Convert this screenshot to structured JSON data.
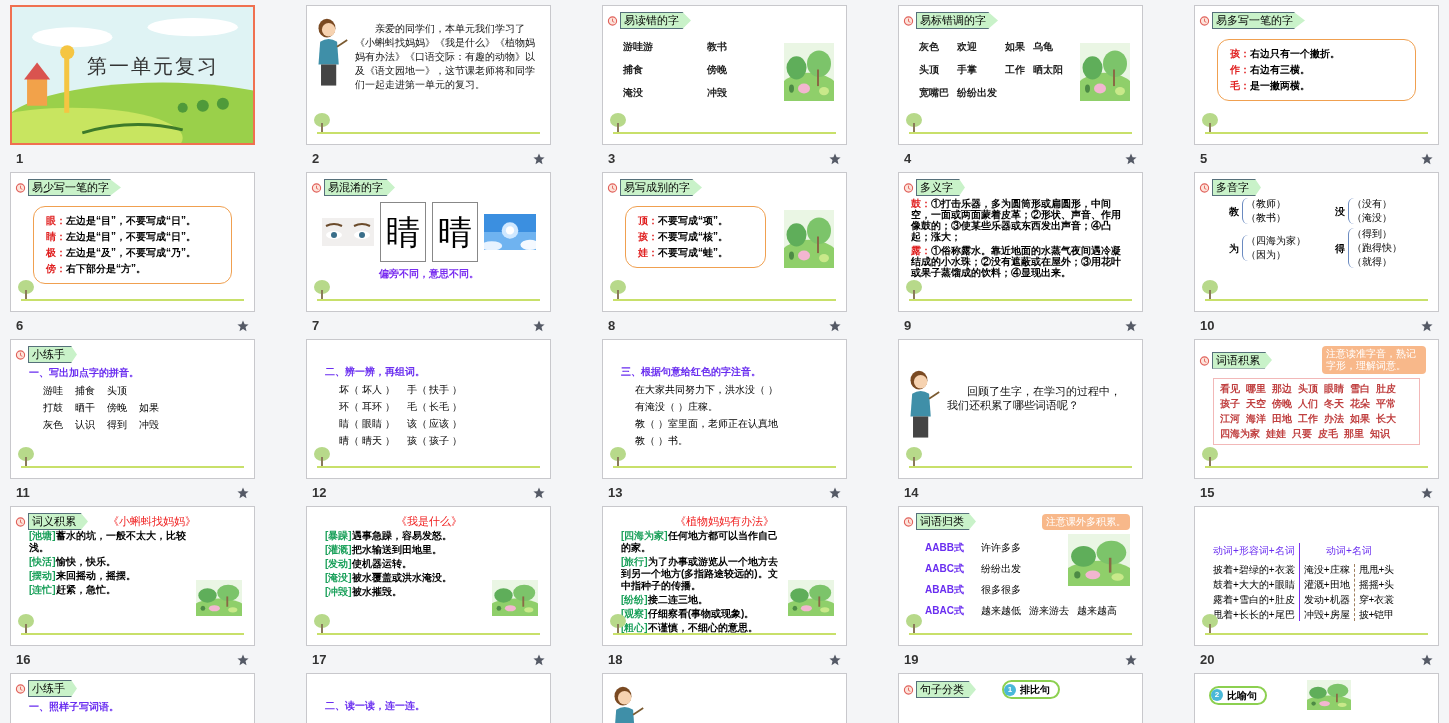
{
  "slides": [
    {
      "number": "1",
      "selected": true,
      "kind": "title",
      "title": "第一单元复习"
    },
    {
      "number": "2",
      "selected": false,
      "animated": true,
      "kind": "teacher",
      "text": "亲爱的同学们，本单元我们学习了《小蝌蚪找妈妈》《我是什么》《植物妈妈有办法》《口语交际：有趣的动物》以及《语文园地一》，这节课老师将和同学们一起走进第一单元的复习。"
    },
    {
      "number": "3",
      "selected": false,
      "animated": true,
      "kind": "words",
      "tag": "易读错的字",
      "picture": true,
      "words": [
        "游哇游",
        "教书",
        "捕食",
        "傍晚",
        "淹没",
        "冲毁"
      ]
    },
    {
      "number": "4",
      "selected": false,
      "animated": true,
      "kind": "words",
      "tag": "易标错调的字",
      "picture": true,
      "words": [
        "灰色",
        "欢迎",
        "如果",
        "乌龟",
        "头顶",
        "手掌",
        "工作",
        "晒太阳",
        "宽嘴巴",
        "纷纷出发"
      ]
    },
    {
      "number": "5",
      "selected": false,
      "animated": true,
      "kind": "boxed",
      "tag": "易多写一笔的字",
      "lines": [
        {
          "label": "孩：",
          "text": "右边只有一个撇折。"
        },
        {
          "label": "作：",
          "text": "右边有三横。"
        },
        {
          "label": "毛：",
          "text": "是一撇两横。"
        }
      ]
    },
    {
      "number": "6",
      "selected": false,
      "animated": true,
      "kind": "boxed",
      "tag": "易少写一笔的字",
      "lines": [
        {
          "label": "眼：",
          "text": "左边是“目”，不要写成“日”。"
        },
        {
          "label": "睛：",
          "text": "左边是“目”，不要写成“日”。"
        },
        {
          "label": "极：",
          "text": "左边是“及”，不要写成“乃”。"
        },
        {
          "label": "傍：",
          "text": "右下部分是“方”。"
        }
      ]
    },
    {
      "number": "7",
      "selected": false,
      "animated": true,
      "kind": "compare",
      "tag": "易混淆的字",
      "chars": [
        "睛",
        "晴"
      ],
      "caption": "偏旁不同，意思不同。"
    },
    {
      "number": "8",
      "selected": false,
      "animated": true,
      "kind": "boxed",
      "tag": "易写成别的字",
      "picture": true,
      "lines": [
        {
          "label": "顶：",
          "text": "不要写成“项”。"
        },
        {
          "label": "孩：",
          "text": "不要写成“核”。"
        },
        {
          "label": "娃：",
          "text": "不要写成“蛙”。"
        }
      ]
    },
    {
      "number": "9",
      "selected": false,
      "animated": true,
      "kind": "defs",
      "tag": "多义字",
      "lines": [
        {
          "label": "鼓：",
          "text": "①打击乐器，多为圆筒形或扁圆形，中间空，一面或两面蒙着皮革；②形状、声音、作用像鼓的；③使某些乐器或东西发出声音；④凸起；涨大；"
        },
        {
          "label": "露：",
          "text": "①俗称露水。靠近地面的水蒸气夜间遇冷凝结成的小水珠；②没有遮蔽或在屋外；③用花叶或果子蒸馏成的饮料；④显现出来。"
        }
      ]
    },
    {
      "number": "10",
      "selected": false,
      "animated": true,
      "kind": "polyphone",
      "tag": "多音字",
      "groups": [
        {
          "char": "教",
          "readings": [
            "（教师）",
            "（教书）"
          ]
        },
        {
          "char": "没",
          "readings": [
            "（没有）",
            "（淹没）"
          ]
        },
        {
          "char": "为",
          "readings": [
            "（四海为家）",
            "（因为）"
          ]
        },
        {
          "char": "得",
          "readings": [
            "（得到）",
            "（跑得快）",
            "（就得）"
          ]
        }
      ]
    },
    {
      "number": "11",
      "selected": false,
      "animated": true,
      "kind": "exercise",
      "tag": "小练手",
      "prompt": "一、写出加点字的拼音。",
      "rows": [
        [
          "游哇",
          "捕食",
          "头顶"
        ],
        [
          "打鼓",
          "晒干",
          "傍晚",
          "如果"
        ],
        [
          "灰色",
          "认识",
          "得到",
          "冲毁"
        ]
      ]
    },
    {
      "number": "12",
      "selected": false,
      "animated": true,
      "kind": "exercise",
      "prompt": "二、辨一辨，再组词。",
      "rows": [
        [
          "坏（ 坏人 ）",
          "手（ 扶手 ）"
        ],
        [
          "环（ 耳环 ）",
          "毛（ 长毛 ）"
        ],
        [
          "睛（ 眼睛 ）",
          "该（ 应该 ）"
        ],
        [
          "晴（ 晴天 ）",
          "孩（ 孩子 ）"
        ]
      ]
    },
    {
      "number": "13",
      "selected": false,
      "animated": true,
      "kind": "exercise",
      "prompt": "三、根据句意给红色的字注音。",
      "rows": [
        [
          "在大家共同努力下，洪水没（  ）"
        ],
        [
          "有淹没（  ）庄稼。"
        ],
        [
          "教（  ）室里面，老师正在认真地"
        ],
        [
          "教（  ）书。"
        ]
      ]
    },
    {
      "number": "14",
      "selected": false,
      "kind": "teacher",
      "text": "回顾了生字，在学习的过程中，我们还积累了哪些词语呢？"
    },
    {
      "number": "15",
      "selected": false,
      "animated": true,
      "kind": "glossary",
      "tag": "词语积累",
      "note": "注意读准字音，熟记字形，理解词意。",
      "words": [
        "看见",
        "哪里",
        "那边",
        "头顶",
        "眼睛",
        "雪白",
        "肚皮",
        "孩子",
        "天空",
        "傍晚",
        "人们",
        "冬天",
        "花朵",
        "平常",
        "江河",
        "海洋",
        "田地",
        "工作",
        "办法",
        "如果",
        "长大",
        "四海为家",
        "娃娃",
        "只要",
        "皮毛",
        "那里",
        "知识"
      ]
    },
    {
      "number": "16",
      "selected": false,
      "animated": true,
      "kind": "meanings",
      "tag": "词义积累",
      "heading": "《小蝌蚪找妈妈》",
      "picture": true,
      "lines": [
        {
          "label": "[池塘]",
          "text": "蓄水的坑，一般不太大，比较浅。"
        },
        {
          "label": "[快活]",
          "text": "愉快，快乐。"
        },
        {
          "label": "[摆动]",
          "text": "来回摇动，摇摆。"
        },
        {
          "label": "[连忙]",
          "text": "赶紧，急忙。"
        }
      ]
    },
    {
      "number": "17",
      "selected": false,
      "animated": true,
      "kind": "meanings",
      "heading": "《我是什么》",
      "picture": true,
      "lines": [
        {
          "label": "[暴躁]",
          "text": "遇事急躁，容易发怒。"
        },
        {
          "label": "[灌溉]",
          "text": "把水输送到田地里。"
        },
        {
          "label": "[发动]",
          "text": "使机器运转。"
        },
        {
          "label": "[淹没]",
          "text": "被水覆盖或洪水淹没。"
        },
        {
          "label": "[冲毁]",
          "text": "被水摧毁。"
        }
      ]
    },
    {
      "number": "18",
      "selected": false,
      "animated": true,
      "kind": "meanings",
      "heading": "《植物妈妈有办法》",
      "picture": true,
      "lines": [
        {
          "label": "[四海为家]",
          "text": "任何地方都可以当作自己的家。"
        },
        {
          "label": "[旅行]",
          "text": "为了办事或游览从一个地方去到另一个地方(多指路途较远的)。文中指种子的传播。"
        },
        {
          "label": "[纷纷]",
          "text": "接二连三地。"
        },
        {
          "label": "[观察]",
          "text": "仔细察看(事物或现象)。"
        },
        {
          "label": "[粗心]",
          "text": "不谨慎，不细心的意思。"
        }
      ]
    },
    {
      "number": "19",
      "selected": false,
      "animated": true,
      "kind": "classify",
      "tag": "词语归类",
      "note": "注意课外多积累。",
      "picture": true,
      "rows": [
        {
          "pattern": "AABB式",
          "examples": [
            "许许多多"
          ]
        },
        {
          "pattern": "AABC式",
          "examples": [
            "纷纷出发"
          ]
        },
        {
          "pattern": "ABAB式",
          "examples": [
            "很多很多"
          ]
        },
        {
          "pattern": "ABAC式",
          "examples": [
            "越来越低",
            "游来游去",
            "越来越高"
          ]
        }
      ]
    },
    {
      "number": "20",
      "selected": false,
      "animated": true,
      "kind": "phrases",
      "columns": [
        {
          "heading": "动词+形容词+名词",
          "groups": [
            [
              "披着+碧绿的+衣裳",
              "鼓着+大大的+眼睛",
              "露着+雪白的+肚皮",
              "甩着+长长的+尾巴"
            ]
          ]
        },
        {
          "heading": "动词+名词",
          "groups": [
            [
              "淹没+庄稼",
              "灌溉+田地",
              "发动+机器",
              "冲毁+房屋"
            ],
            [
              "甩甩+头",
              "摇摇+头",
              "穿+衣裳",
              "披+铠甲"
            ]
          ]
        }
      ]
    },
    {
      "selected": false,
      "kind": "exercise",
      "tag": "小练手",
      "prompt": "一、照样子写词语。"
    },
    {
      "selected": false,
      "kind": "exercise",
      "prompt": "二、读一读，连一连。"
    },
    {
      "selected": false,
      "kind": "teacher"
    },
    {
      "selected": false,
      "kind": "sentence",
      "tag": "句子分类",
      "badge": {
        "number": "1",
        "label": "排比句"
      }
    },
    {
      "selected": false,
      "kind": "sentence",
      "picture": true,
      "badge": {
        "number": "2",
        "label": "比喻句"
      }
    }
  ]
}
